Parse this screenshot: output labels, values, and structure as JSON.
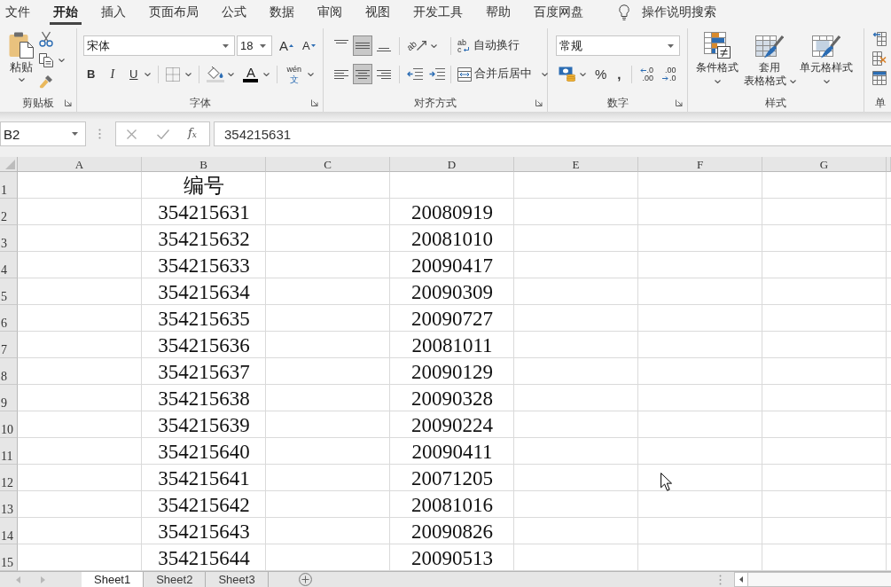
{
  "menu_tabs": [
    {
      "label": "文件",
      "selected": false
    },
    {
      "label": "开始",
      "selected": true
    },
    {
      "label": "插入",
      "selected": false
    },
    {
      "label": "页面布局",
      "selected": false
    },
    {
      "label": "公式",
      "selected": false
    },
    {
      "label": "数据",
      "selected": false
    },
    {
      "label": "审阅",
      "selected": false
    },
    {
      "label": "视图",
      "selected": false
    },
    {
      "label": "开发工具",
      "selected": false
    },
    {
      "label": "帮助",
      "selected": false
    },
    {
      "label": "百度网盘",
      "selected": false
    }
  ],
  "tell_me": "操作说明搜索",
  "clipboard": {
    "title": "剪贴板",
    "paste": "粘贴"
  },
  "font": {
    "title": "字体",
    "font_name": "宋体",
    "font_size": "18",
    "grow": "A",
    "shrink": "A",
    "bold": "B",
    "italic": "I",
    "underline": "U",
    "font_color": "A",
    "phonetic": [
      "wén",
      "文"
    ]
  },
  "alignment": {
    "title": "对齐方式",
    "vertical": [
      {
        "kind": "top",
        "selected": false
      },
      {
        "kind": "middle",
        "selected": true
      },
      {
        "kind": "bottom",
        "selected": false
      }
    ],
    "horizontal": [
      {
        "kind": "left",
        "selected": false
      },
      {
        "kind": "center",
        "selected": true
      },
      {
        "kind": "right",
        "selected": false
      }
    ],
    "orientation": "ab",
    "wrap_glyph": [
      "ab",
      "c"
    ],
    "wrap_text": "自动换行",
    "merge": "合并后居中"
  },
  "number": {
    "title": "数字",
    "format": "常规",
    "percent": "%",
    "comma": ",",
    "increase_decimal": [
      ".0",
      ".00"
    ],
    "decrease_decimal": [
      ".00",
      ".0"
    ]
  },
  "styles": {
    "title": "样式",
    "buttons": [
      {
        "kind": "conditional",
        "lines": [
          "条件格式"
        ]
      },
      {
        "kind": "table",
        "lines": [
          "套用",
          "表格格式"
        ]
      },
      {
        "kind": "cell",
        "lines": [
          "单元格样式"
        ]
      }
    ]
  },
  "cells": {
    "title": "单"
  },
  "formula_bar": {
    "name_box": "B2",
    "function": "f$_{x}$",
    "value": "354215631"
  },
  "sheet": {
    "columns": [
      "A",
      "B",
      "C",
      "D",
      "E",
      "F",
      "G"
    ],
    "rows": [
      {
        "number": "1",
        "b": "编号"
      },
      {
        "number": "2",
        "b": "354215631",
        "d": "20080919"
      },
      {
        "number": "3",
        "b": "354215632",
        "d": "20081010"
      },
      {
        "number": "4",
        "b": "354215633",
        "d": "20090417"
      },
      {
        "number": "5",
        "b": "354215634",
        "d": "20090309"
      },
      {
        "number": "6",
        "b": "354215635",
        "d": "20090727"
      },
      {
        "number": "7",
        "b": "354215636",
        "d": "20081011"
      },
      {
        "number": "8",
        "b": "354215637",
        "d": "20090129"
      },
      {
        "number": "9",
        "b": "354215638",
        "d": "20090328"
      },
      {
        "number": "10",
        "b": "354215639",
        "d": "20090224"
      },
      {
        "number": "11",
        "b": "354215640",
        "d": "20090411"
      },
      {
        "number": "12",
        "b": "354215641",
        "d": "20071205"
      },
      {
        "number": "13",
        "b": "354215642",
        "d": "20081016"
      },
      {
        "number": "14",
        "b": "354215643",
        "d": "20090826"
      },
      {
        "number": "15",
        "b": "354215644",
        "d": "20090513"
      }
    ]
  },
  "sheet_tabs": [
    {
      "label": "Sheet1",
      "selected": true
    },
    {
      "label": "Sheet2",
      "selected": false
    },
    {
      "label": "Sheet3",
      "selected": false
    }
  ]
}
